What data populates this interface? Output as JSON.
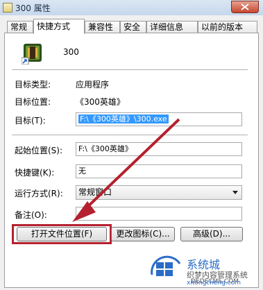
{
  "window": {
    "title": "300 属性"
  },
  "tabs": [
    "常规",
    "快捷方式",
    "兼容性",
    "安全",
    "详细信息",
    "以前的版本"
  ],
  "shortcut": {
    "name": "300",
    "rows": [
      {
        "label": "目标类型:",
        "value": "应用程序"
      },
      {
        "label": "目标位置:",
        "value": "《300英雄》"
      },
      {
        "label": "目标(T):",
        "value": "F:\\《300英雄》\\300.exe"
      },
      {
        "label": "起始位置(S):",
        "value": "F:\\《300英雄》"
      },
      {
        "label": "快捷键(K):",
        "value": "无"
      },
      {
        "label": "运行方式(R):",
        "value": "常规窗口"
      },
      {
        "label": "备注(O):",
        "value": ""
      }
    ],
    "buttons": [
      "打开文件位置(F)",
      "更改图标(C)...",
      "高级(D)..."
    ]
  },
  "watermark": {
    "logo_text": "系统城",
    "line1": "织梦内容管理系统",
    "line2": "DEDECMS.COM",
    "line3": "xitongcheng.com"
  },
  "colors": {
    "accent_red": "#b5202e",
    "selection": "#3399ff",
    "watermark_blue": "#2a6cc7"
  }
}
